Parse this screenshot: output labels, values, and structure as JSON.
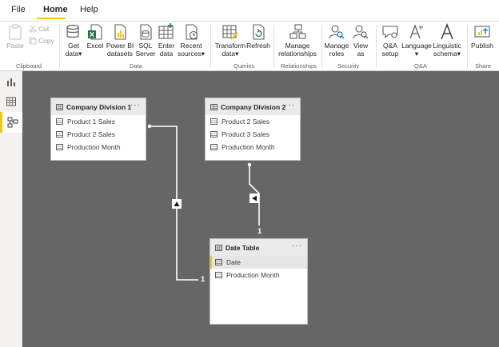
{
  "tabs": [
    {
      "label": "File"
    },
    {
      "label": "Home"
    },
    {
      "label": "Help"
    }
  ],
  "ribbon": {
    "clipboard": {
      "paste": "Paste",
      "cut": "Cut",
      "copy": "Copy",
      "group": "Clipboard"
    },
    "data": {
      "get_data": [
        "Get",
        "data"
      ],
      "excel": "Excel",
      "power_bi": [
        "Power BI",
        "datasets"
      ],
      "sql": [
        "SQL",
        "Server"
      ],
      "enter_data": [
        "Enter",
        "data"
      ],
      "recent": [
        "Recent",
        "sources"
      ],
      "group": "Data"
    },
    "queries": {
      "transform": [
        "Transform",
        "data"
      ],
      "refresh": "Refresh",
      "group": "Queries"
    },
    "relationships": {
      "manage": [
        "Manage",
        "relationships"
      ],
      "group": "Relationships"
    },
    "security": {
      "manage_roles": [
        "Manage",
        "roles"
      ],
      "view_as": [
        "View",
        "as"
      ],
      "group": "Security"
    },
    "qa": {
      "qa_setup": [
        "Q&A",
        "setup"
      ],
      "language": "Language",
      "linguistic": [
        "Linguistic",
        "schema"
      ],
      "group": "Q&A"
    },
    "share": {
      "publish": "Publish",
      "group": "Share"
    }
  },
  "rail": [
    {
      "icon": "report-view-icon"
    },
    {
      "icon": "data-view-icon"
    },
    {
      "icon": "model-view-icon"
    }
  ],
  "model": {
    "tables": [
      {
        "title": "Company Division 1",
        "fields": [
          "Product 1 Sales",
          "Product 2 Sales",
          "Production Month"
        ]
      },
      {
        "title": "Company Division 2",
        "fields": [
          "Product 2 Sales",
          "Product 3 Sales",
          "Production Month"
        ]
      },
      {
        "title": "Date Table",
        "fields": [
          "Date",
          "Production Month"
        ]
      }
    ],
    "more": "···",
    "cardinality_one": "1"
  },
  "colors": {
    "accent": "#f2c811",
    "canvas": "#666666",
    "card_header": "#eaeaea"
  }
}
